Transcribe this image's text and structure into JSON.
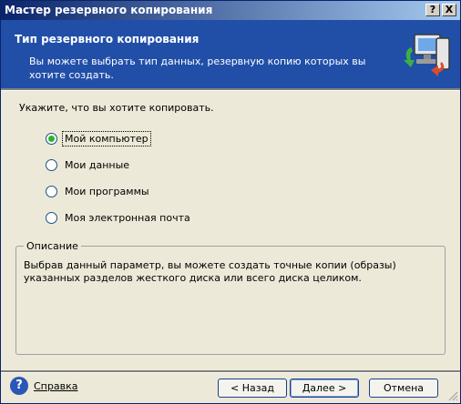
{
  "window": {
    "title": "Мастер резервного копирования",
    "title_buttons": [
      "?",
      "X"
    ]
  },
  "header": {
    "title": "Тип резервного копирования",
    "description": "Вы можете выбрать тип данных, резервную копию которых вы хотите создать.",
    "icon": "backup-wizard-icon"
  },
  "main": {
    "prompt": "Укажите, что вы хотите копировать.",
    "options": [
      {
        "label": "Мой компьютер",
        "selected": true
      },
      {
        "label": "Мои данные",
        "selected": false
      },
      {
        "label": "Мои программы",
        "selected": false
      },
      {
        "label": "Моя электронная почта",
        "selected": false
      }
    ],
    "description_group": {
      "legend": "Описание",
      "text": "Выбрав данный параметр, вы можете создать точные копии (образы) указанных разделов жесткого диска или всего диска целиком."
    }
  },
  "footer": {
    "help_label": "Справка",
    "back_label": "< Назад",
    "next_label": "Далее >",
    "cancel_label": "Отмена"
  },
  "colors": {
    "header_bg": "#214fa8",
    "selected_radio": "#2bb32b",
    "titlebar_start": "#0a246a",
    "titlebar_end": "#a6caf0"
  }
}
